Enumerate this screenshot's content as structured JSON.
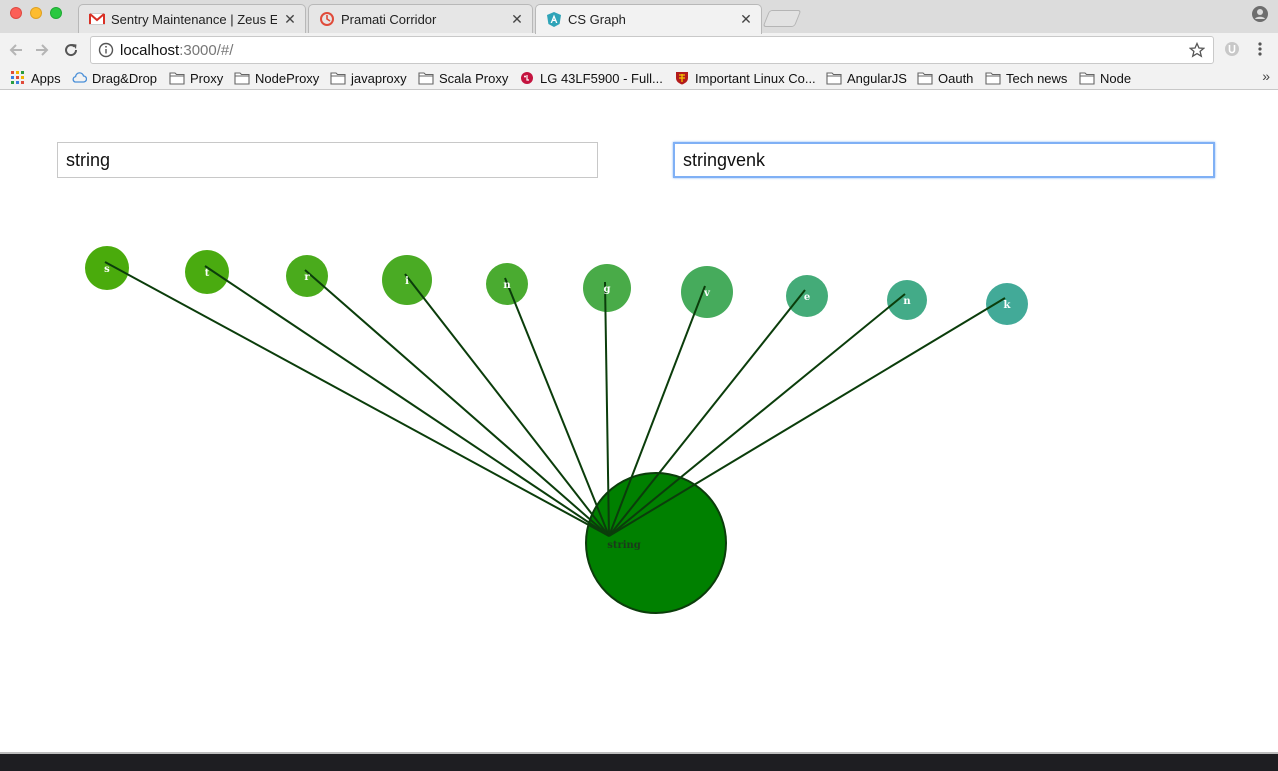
{
  "browser": {
    "tabs": [
      {
        "title": "Sentry Maintenance | Zeus Em",
        "icon": "gmail-icon"
      },
      {
        "title": "Pramati Corridor",
        "icon": "pramati-icon"
      },
      {
        "title": "CS Graph",
        "icon": "angular-icon",
        "active": true
      }
    ],
    "url_host": "localhost",
    "url_path": ":3000/#/",
    "bookmarks": [
      {
        "label": "Apps",
        "icon": "apps-grid-icon"
      },
      {
        "label": "Drag&Drop",
        "icon": "cloud-icon"
      },
      {
        "label": "Proxy",
        "icon": "folder-icon"
      },
      {
        "label": "NodeProxy",
        "icon": "folder-icon"
      },
      {
        "label": "javaproxy",
        "icon": "folder-icon"
      },
      {
        "label": "Scala Proxy",
        "icon": "folder-icon"
      },
      {
        "label": "LG 43LF5900 - Full...",
        "icon": "lg-icon"
      },
      {
        "label": "Important Linux Co...",
        "icon": "shield-crest-icon"
      },
      {
        "label": "AngularJS",
        "icon": "folder-icon"
      },
      {
        "label": "Oauth",
        "icon": "folder-icon"
      },
      {
        "label": "Tech news",
        "icon": "folder-icon"
      },
      {
        "label": "Node",
        "icon": "folder-icon"
      }
    ],
    "more_label": "»"
  },
  "inputs": {
    "source_value": "string",
    "target_value": "stringvenk"
  },
  "graph": {
    "root": {
      "label": "string",
      "color": "#008000"
    },
    "nodes": [
      {
        "label": "s",
        "color": "#4aab0c"
      },
      {
        "label": "t",
        "color": "#4aab10"
      },
      {
        "label": "r",
        "color": "#4aab1c"
      },
      {
        "label": "i",
        "color": "#4aab24"
      },
      {
        "label": "n",
        "color": "#4aab30"
      },
      {
        "label": "g",
        "color": "#49ab48"
      },
      {
        "label": "v",
        "color": "#46ab5c"
      },
      {
        "label": "e",
        "color": "#44ab78"
      },
      {
        "label": "n",
        "color": "#43ab88"
      },
      {
        "label": "k",
        "color": "#42aa98"
      }
    ],
    "link_color": "#0b3d0b"
  }
}
